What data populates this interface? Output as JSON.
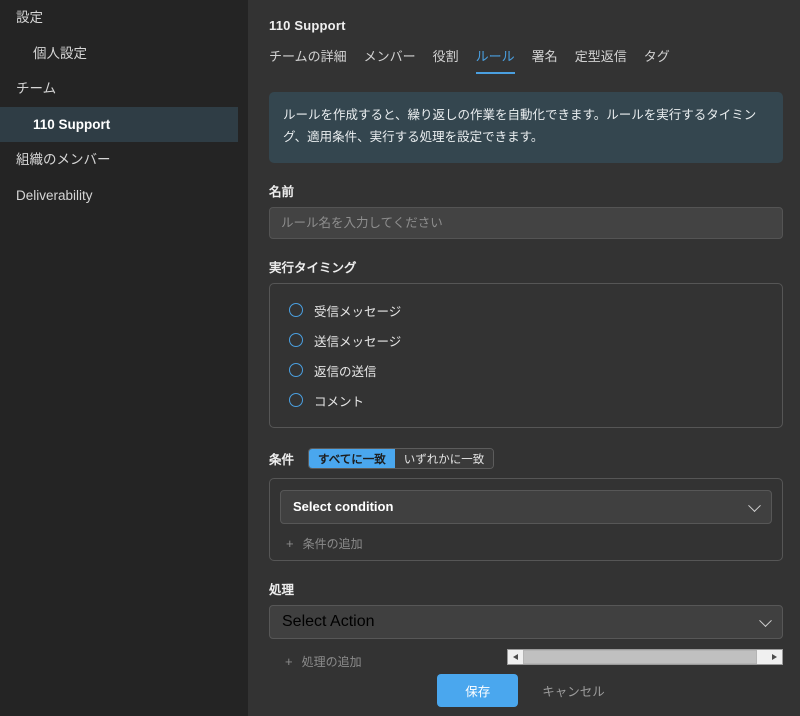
{
  "sidebar": {
    "items": [
      {
        "label": "設定",
        "indent": false,
        "active": false
      },
      {
        "label": "個人設定",
        "indent": true,
        "active": false
      },
      {
        "label": "チーム",
        "indent": false,
        "active": false
      },
      {
        "label": "110 Support",
        "indent": true,
        "active": true
      },
      {
        "label": "組織のメンバー",
        "indent": false,
        "active": false
      },
      {
        "label": "Deliverability",
        "indent": false,
        "active": false
      }
    ]
  },
  "header": {
    "title": "110 Support"
  },
  "tabs": [
    {
      "label": "チームの詳細",
      "active": false
    },
    {
      "label": "メンバー",
      "active": false
    },
    {
      "label": "役割",
      "active": false
    },
    {
      "label": "ルール",
      "active": true
    },
    {
      "label": "署名",
      "active": false
    },
    {
      "label": "定型返信",
      "active": false
    },
    {
      "label": "タグ",
      "active": false
    }
  ],
  "banner": {
    "text": "ルールを作成すると、繰り返しの作業を自動化できます。ルールを実行するタイミング、適用条件、実行する処理を設定できます。"
  },
  "name_field": {
    "label": "名前",
    "value": "",
    "placeholder": "ルール名を入力してください"
  },
  "timing": {
    "label": "実行タイミング",
    "options": [
      {
        "label": "受信メッセージ",
        "checked": false
      },
      {
        "label": "送信メッセージ",
        "checked": false
      },
      {
        "label": "返信の送信",
        "checked": false
      },
      {
        "label": "コメント",
        "checked": false
      }
    ]
  },
  "conditions": {
    "label": "条件",
    "match_all_label": "すべてに一致",
    "match_any_label": "いずれかに一致",
    "selected_match": "すべてに一致",
    "select_placeholder": "Select condition",
    "add_label": "条件の追加",
    "add_plus": "+"
  },
  "actions": {
    "label": "処理",
    "select_placeholder": "Select Action",
    "add_label": "処理の追加",
    "add_plus": "+"
  },
  "footer": {
    "save_label": "保存",
    "cancel_label": "キャンセル"
  },
  "colors": {
    "accent": "#4aa7ee",
    "tab_active": "#4a9fe0",
    "banner_bg": "#34464f",
    "sidebar_bg": "#242424",
    "main_bg": "#333333",
    "sidebar_active_bg": "#2f3d45"
  }
}
